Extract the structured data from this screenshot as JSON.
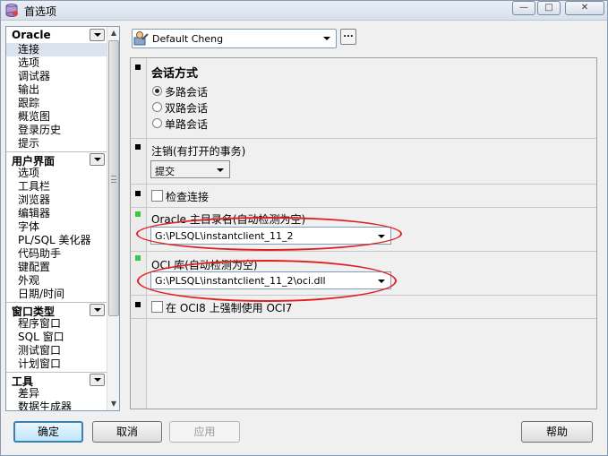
{
  "window": {
    "title": "首选项",
    "buttons": {
      "min": "—",
      "max": "□",
      "close": "✕"
    }
  },
  "nav": {
    "groups": [
      {
        "header": "Oracle",
        "items": [
          "连接",
          "选项",
          "调试器",
          "输出",
          "跟踪",
          "概览图",
          "登录历史",
          "提示"
        ]
      },
      {
        "header": "用户界面",
        "items": [
          "选项",
          "工具栏",
          "浏览器",
          "编辑器",
          "字体",
          "PL/SQL 美化器",
          "代码助手",
          "键配置",
          "外观",
          "日期/时间"
        ]
      },
      {
        "header": "窗口类型",
        "items": [
          "程序窗口",
          "SQL 窗口",
          "测试窗口",
          "计划窗口"
        ]
      },
      {
        "header": "工具",
        "items": [
          "差异",
          "数据生成器"
        ]
      }
    ],
    "selected": "连接"
  },
  "profile": {
    "value": "Default Cheng",
    "ellipsis": "..."
  },
  "sections": {
    "session_mode": {
      "title": "会话方式",
      "options": [
        "多路会话",
        "双路会话",
        "单路会话"
      ],
      "selected": "多路会话"
    },
    "logoff": {
      "title": "注销(有打开的事务)",
      "value": "提交"
    },
    "check_connection": {
      "label": "检查连接"
    },
    "oracle_home": {
      "title": "Oracle 主目录名(自动检测为空)",
      "value": "G:\\PLSQL\\instantclient_11_2"
    },
    "oci_library": {
      "title": "OCI 库(自动检测为空)",
      "value": "G:\\PLSQL\\instantclient_11_2\\oci.dll"
    },
    "force_oci7": {
      "label": "在 OCI8 上强制使用 OCI7"
    }
  },
  "footer": {
    "ok": "确定",
    "cancel": "取消",
    "apply": "应用",
    "help": "帮助"
  },
  "colors": {
    "annotation": "#e02020",
    "marker_active": "#3cc83c",
    "marker": "#000000"
  }
}
